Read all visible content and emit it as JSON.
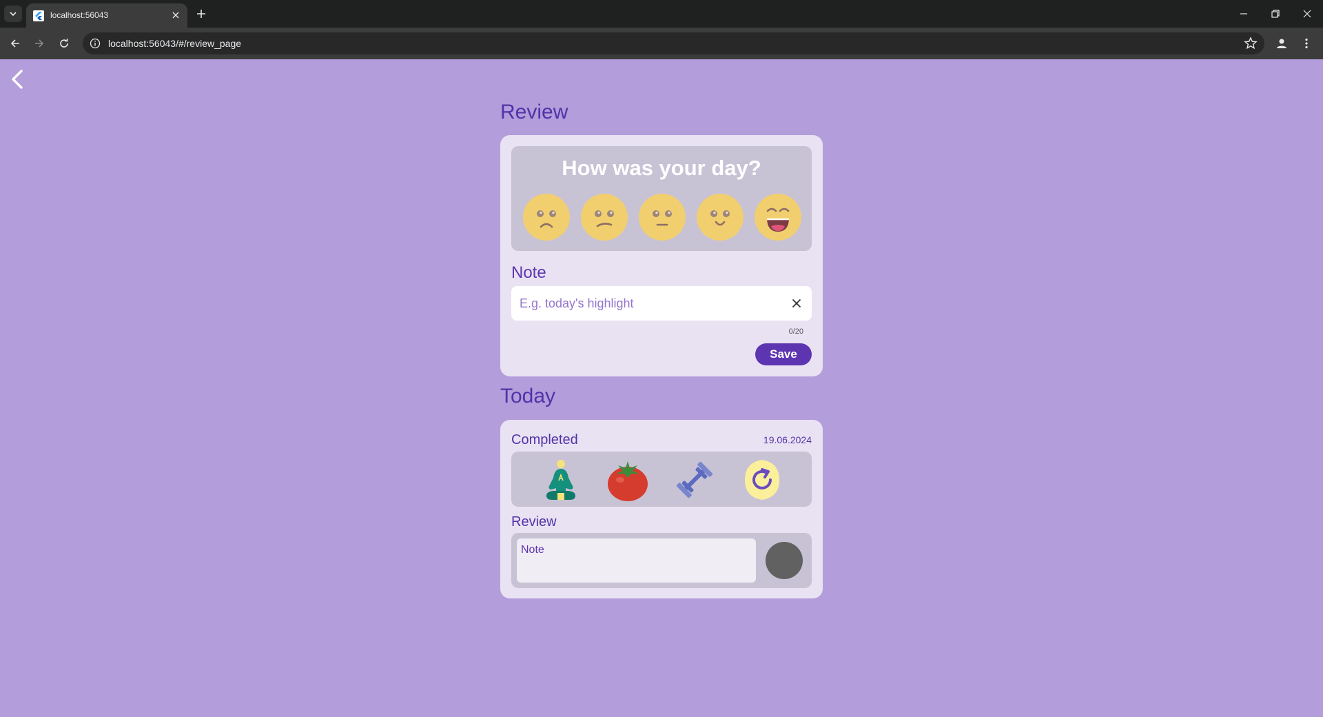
{
  "browser": {
    "tab_title": "localhost:56043",
    "url": "localhost:56043/#/review_page"
  },
  "review_section": {
    "title": "Review",
    "question": "How was your day?",
    "moods": [
      "awful",
      "bad",
      "neutral",
      "good",
      "great"
    ],
    "note_label": "Note",
    "note_placeholder": "E.g. today's highlight",
    "note_value": "",
    "counter": "0/20",
    "save_label": "Save"
  },
  "today_section": {
    "title": "Today",
    "completed_label": "Completed",
    "date": "19.06.2024",
    "activities": [
      "meditation-icon",
      "tomato-icon",
      "dumbbell-icon",
      "refresh-icon"
    ],
    "review_label": "Review",
    "review_note": "Note",
    "mood_color": "#616161"
  },
  "colors": {
    "background": "#b39ddb",
    "accent": "#5e35b1",
    "card": "#e9e2f3",
    "inner_box": "#c8c2d5"
  }
}
